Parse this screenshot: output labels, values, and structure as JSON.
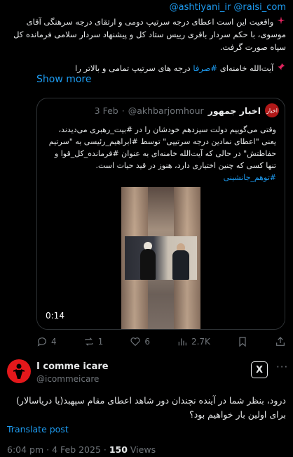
{
  "top_tweet": {
    "mentions": "@ashtiyani_ir @raisi_com",
    "paragraph1": "واقعیت این است اعطای درجه سرتیپ دومی و ارتقای درجه سرهنگی آقای موسوی، با حکم سردار باقری رییس ستاد کل و پیشنهاد سردار سلامی فرمانده کل سپاه صورت گرفت.",
    "paragraph2_pre": "آیت‌الله خامنه‌ای ",
    "paragraph2_hashtag": "#صرفا",
    "paragraph2_post": " درجه های سرتیپ تمامی و بالاتر را",
    "show_more": "Show more"
  },
  "quote": {
    "avatar_text": "اخبار",
    "name": "اخبار جمهور",
    "handle": "@akhbarjomhour",
    "dot": "·",
    "date": "3 Feb",
    "body": "وقتی می‌گوییم دولت سیزدهم خودشان را در #بیت_رهبری می‌دیدند، یعنی \"اعطای نمادین درجه سرتیپی\" توسط #ابراهیم_رئیسی به \"سرتیم حفاظتش\" در حالی که آیت‌الله خامنه‌ای به عنوان #فرمانده_کل_قوا و تنها کسی که چنین اختیاری دارد، هنوز در قید حیات است.",
    "hashtag": "#توهم_جانشینی",
    "video_time": "0:14"
  },
  "actions": {
    "replies": "4",
    "reposts": "1",
    "likes": "6",
    "views": "2.7K"
  },
  "reply": {
    "name": "I comme icare",
    "handle": "@icommeicare",
    "grok_label": "X",
    "more_label": "···",
    "text": "درود، بنظر شما در آینده نچندان دور شاهد اعطای مقام سپهبد(یا دریاسالار) برای اولین بار خواهیم بود؟",
    "translate": "Translate post",
    "time": "6:04 pm · 4 Feb 2025 · ",
    "views_count": "150",
    "views_label": " Views"
  },
  "colors": {
    "link": "#1d9bf0",
    "muted": "#71767b",
    "text": "#e7e9ea",
    "bg": "#000000",
    "avatar_red": "#e4181b"
  }
}
